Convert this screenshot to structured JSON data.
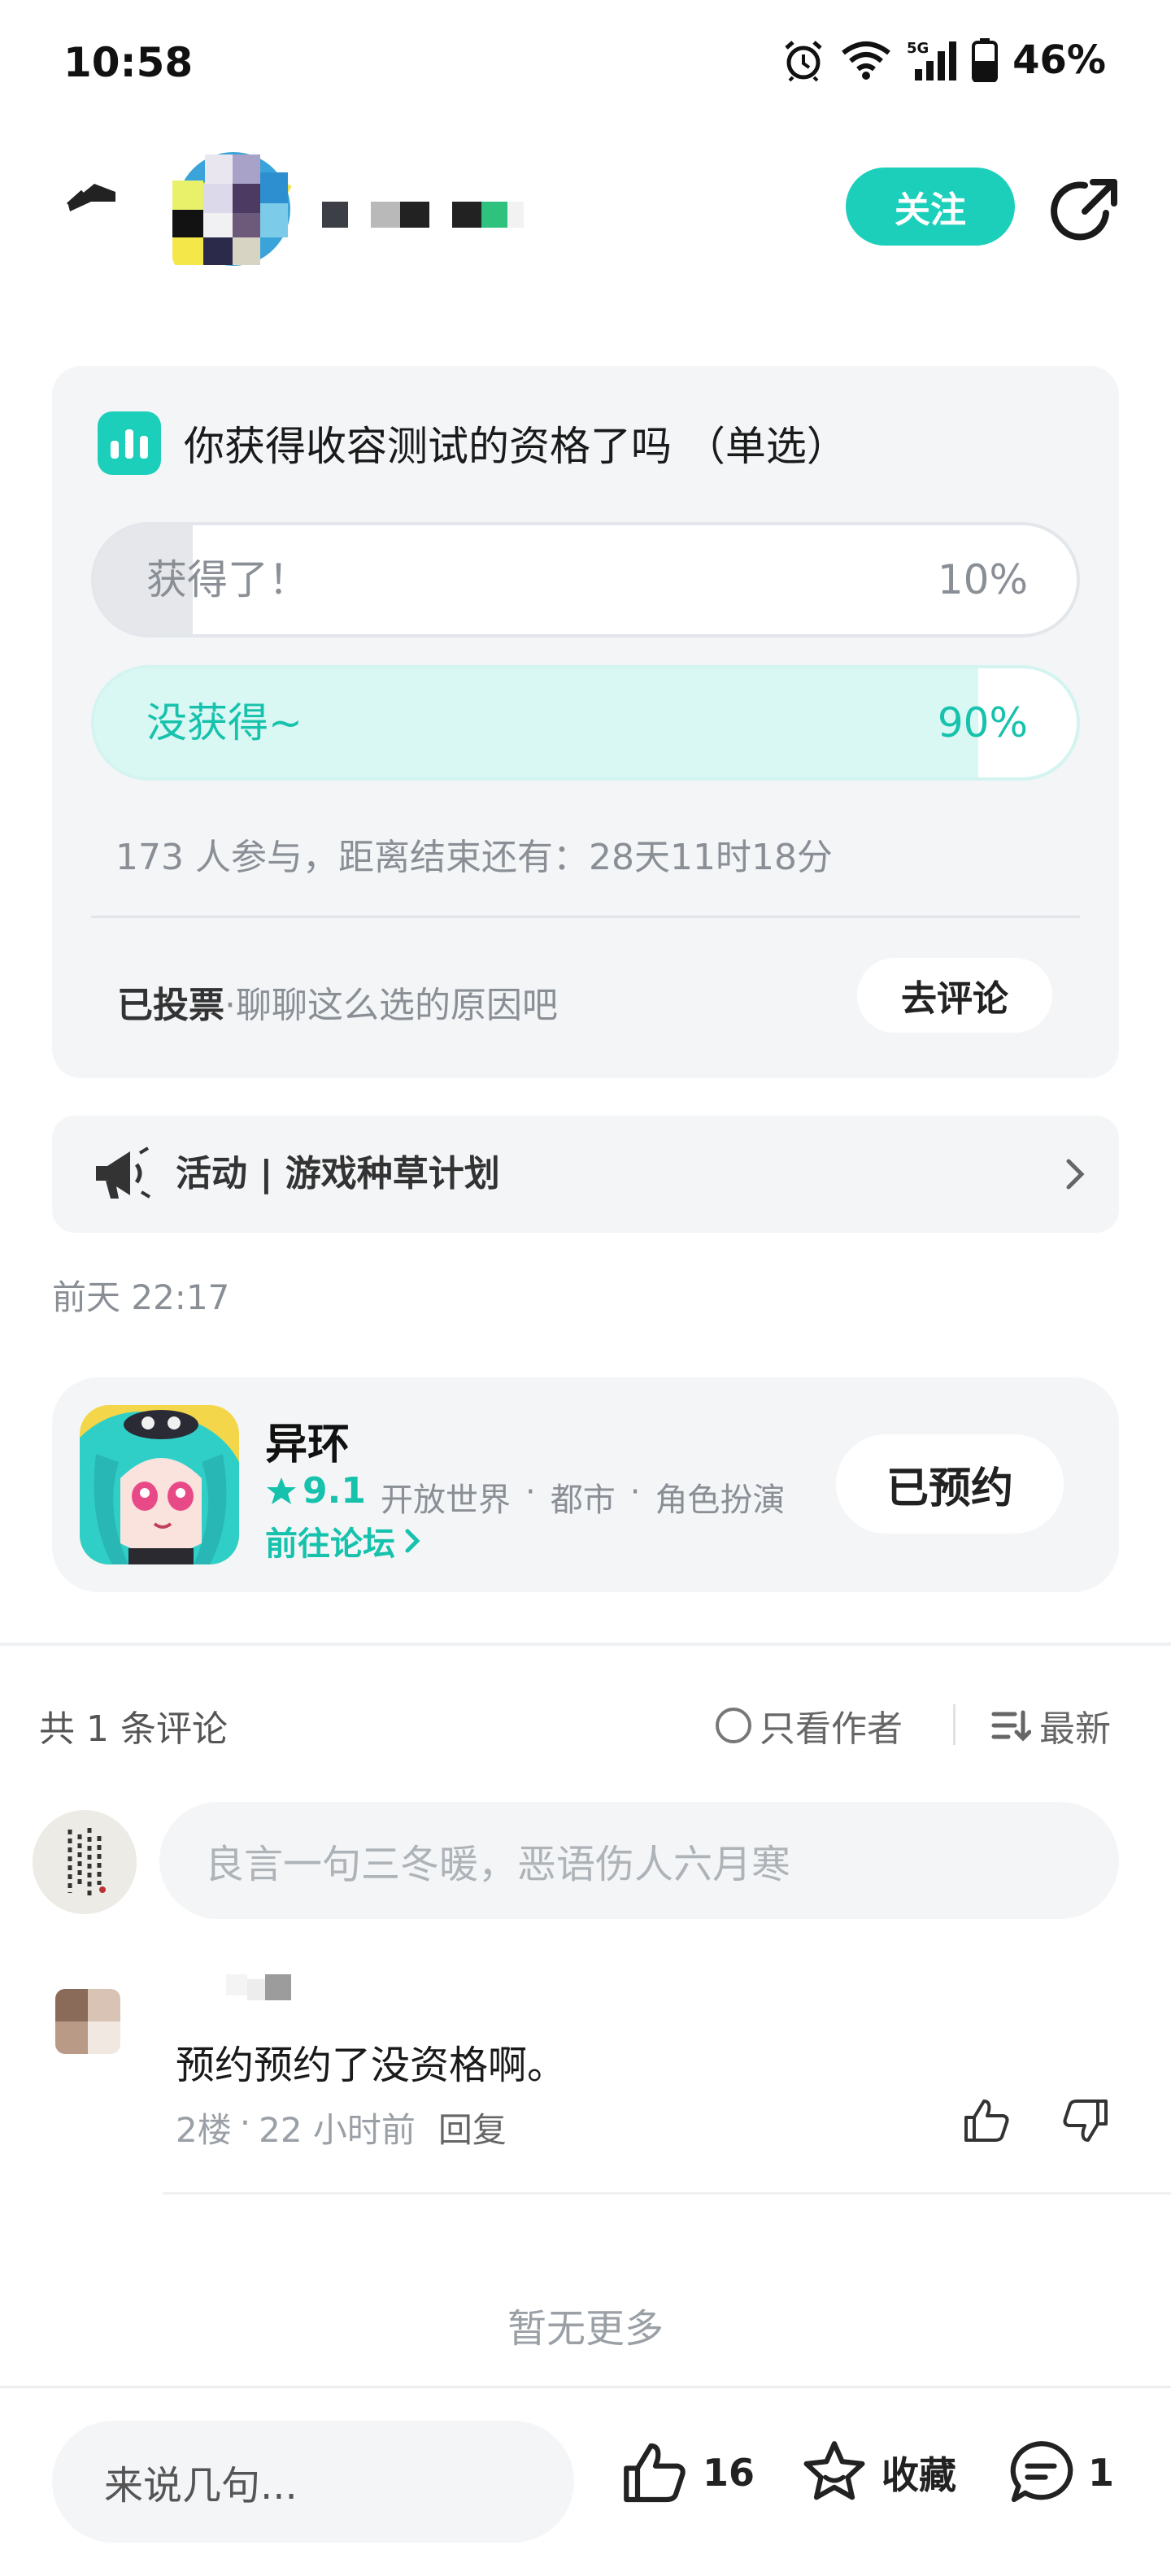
{
  "status_bar": {
    "time": "10:58",
    "network": "5G",
    "battery": "46%",
    "icons": [
      "alarm-icon",
      "wifi-icon",
      "signal-icon",
      "battery-icon"
    ]
  },
  "header": {
    "follow_label": "关注",
    "icons": [
      "back-icon",
      "share-icon"
    ]
  },
  "poll": {
    "question": "你获得收容测试的资格了吗 （单选）",
    "options": [
      {
        "label": "获得了！",
        "percent_text": "10%",
        "fraction": 0.1
      },
      {
        "label": "没获得~",
        "percent_text": "90%",
        "fraction": 0.9
      }
    ],
    "meta": "173 人参与，距离结束还有：28天11时18分",
    "voted_status": "已投票",
    "voted_hint": "·聊聊这么选的原因吧",
    "comment_button": "去评论"
  },
  "activity": {
    "text": "活动 | 游戏种草计划"
  },
  "post_time": "前天 22:17",
  "game": {
    "name": "异环",
    "rating": "9.1",
    "tags": [
      "开放世界",
      "·",
      "都市",
      "·",
      "角色扮演"
    ],
    "forum_link": "前往论坛",
    "reserve_label": "已预约"
  },
  "comments": {
    "count_text": "共 1 条评论",
    "author_only": "只看作者",
    "sort": "最新",
    "input_placeholder": "良言一句三冬暖，恶语伤人六月寒",
    "items": [
      {
        "text": "预约预约了没资格啊。",
        "floor": "2楼",
        "dot": "·",
        "time": "22 小时前",
        "reply": "回复"
      }
    ],
    "no_more": "暂无更多"
  },
  "bottom_bar": {
    "input_placeholder": "来说几句...",
    "like_count": "16",
    "favorite_label": "收藏",
    "comment_count": "1"
  },
  "colors": {
    "accent": "#1ccfbb",
    "accent_text": "#17c2ad",
    "card_bg": "#f3f5f7",
    "muted_text": "#8a8f96"
  }
}
